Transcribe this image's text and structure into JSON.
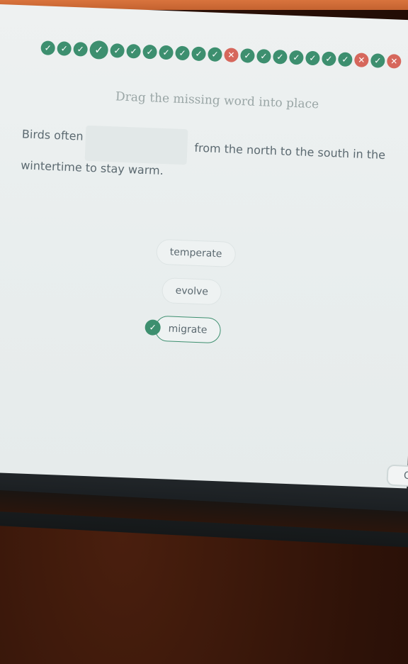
{
  "progress": {
    "dots": [
      {
        "status": "correct",
        "glyph": "✓"
      },
      {
        "status": "correct",
        "glyph": "✓"
      },
      {
        "status": "correct",
        "glyph": "✓"
      },
      {
        "status": "current",
        "glyph": "✓"
      },
      {
        "status": "correct",
        "glyph": "✓"
      },
      {
        "status": "correct",
        "glyph": "✓"
      },
      {
        "status": "correct",
        "glyph": "✓"
      },
      {
        "status": "correct",
        "glyph": "✓"
      },
      {
        "status": "correct",
        "glyph": "✓"
      },
      {
        "status": "correct",
        "glyph": "✓"
      },
      {
        "status": "correct",
        "glyph": "✓"
      },
      {
        "status": "incorrect",
        "glyph": "✕"
      },
      {
        "status": "correct",
        "glyph": "✓"
      },
      {
        "status": "correct",
        "glyph": "✓"
      },
      {
        "status": "correct",
        "glyph": "✓"
      },
      {
        "status": "correct",
        "glyph": "✓"
      },
      {
        "status": "correct",
        "glyph": "✓"
      },
      {
        "status": "correct",
        "glyph": "✓"
      },
      {
        "status": "correct",
        "glyph": "✓"
      },
      {
        "status": "incorrect",
        "glyph": "✕"
      },
      {
        "status": "correct",
        "glyph": "✓"
      },
      {
        "status": "incorrect",
        "glyph": "✕"
      }
    ],
    "colors": {
      "correct": "#3d8f6f",
      "incorrect": "#d6675c"
    }
  },
  "question": {
    "instruction": "Drag the missing word into place",
    "sentence_before": "Birds often",
    "sentence_after": "from the north to the south in the",
    "sentence_line2": "wintertime to stay warm."
  },
  "choices": [
    {
      "label": "temperate",
      "selected": false
    },
    {
      "label": "evolve",
      "selected": false
    },
    {
      "label": "migrate",
      "selected": true
    }
  ],
  "edge_button": {
    "glyph": "C"
  }
}
